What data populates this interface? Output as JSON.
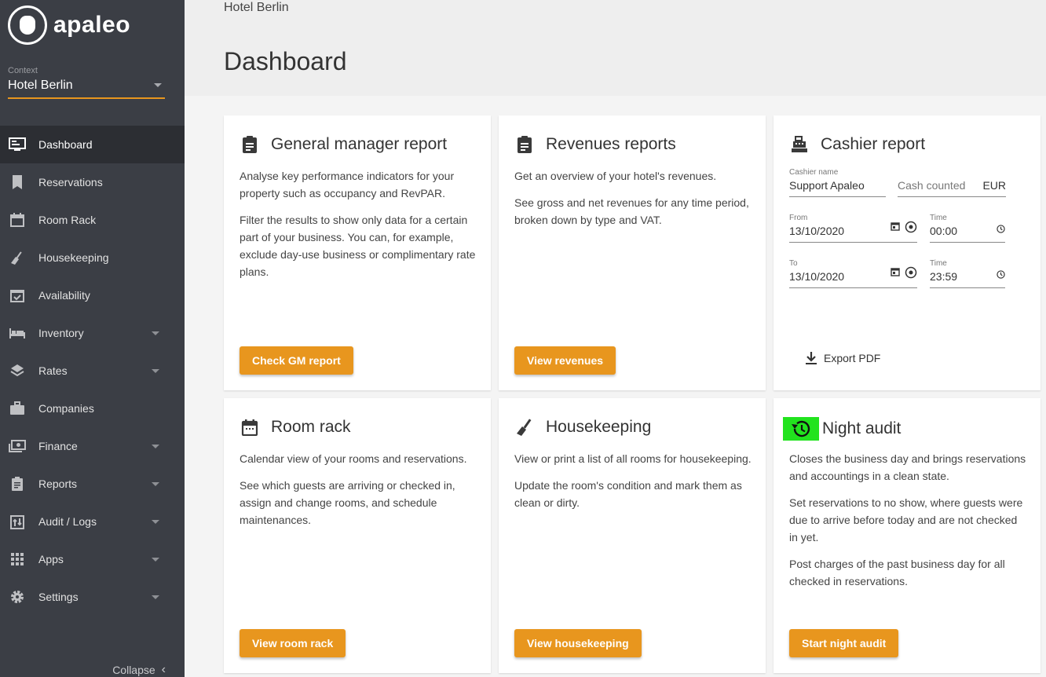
{
  "app": {
    "name": "apaleo"
  },
  "sidebar": {
    "context_label": "Context",
    "context_value": "Hotel Berlin",
    "items": [
      {
        "label": "Dashboard",
        "icon": "monitor-icon",
        "active": true,
        "expandable": false
      },
      {
        "label": "Reservations",
        "icon": "bookmark-icon",
        "expandable": false
      },
      {
        "label": "Room Rack",
        "icon": "calendar-icon",
        "expandable": false
      },
      {
        "label": "Housekeeping",
        "icon": "broom-icon",
        "expandable": false
      },
      {
        "label": "Availability",
        "icon": "calendar-check-icon",
        "expandable": false
      },
      {
        "label": "Inventory",
        "icon": "bed-icon",
        "expandable": true
      },
      {
        "label": "Rates",
        "icon": "layers-icon",
        "expandable": true
      },
      {
        "label": "Companies",
        "icon": "briefcase-icon",
        "expandable": false
      },
      {
        "label": "Finance",
        "icon": "money-icon",
        "expandable": true
      },
      {
        "label": "Reports",
        "icon": "clipboard-icon",
        "expandable": true
      },
      {
        "label": "Audit / Logs",
        "icon": "audit-icon",
        "expandable": true
      },
      {
        "label": "Apps",
        "icon": "apps-grid-icon",
        "expandable": true
      },
      {
        "label": "Settings",
        "icon": "gear-icon",
        "expandable": true
      }
    ],
    "collapse_label": "Collapse"
  },
  "header": {
    "breadcrumb": "Hotel Berlin",
    "title": "Dashboard"
  },
  "cards": {
    "gm": {
      "title": "General manager report",
      "paragraphs": [
        "Analyse key performance indicators for your property such as occupancy and RevPAR.",
        "Filter the results to show only data for a certain part of your business. You can, for example, exclude day-use business or complimentary rate plans."
      ],
      "button": "Check GM report"
    },
    "revenues": {
      "title": "Revenues reports",
      "paragraphs": [
        "Get an overview of your hotel's revenues.",
        "See gross and net revenues for any time period, broken down by type and VAT."
      ],
      "button": "View revenues"
    },
    "cashier": {
      "title": "Cashier report",
      "cashier_name_label": "Cashier name",
      "cashier_name_value": "Support Apaleo",
      "cash_counted_placeholder": "Cash counted",
      "currency": "EUR",
      "from_label": "From",
      "from_date": "13/10/2020",
      "from_time_label": "Time",
      "from_time": "00:00",
      "to_label": "To",
      "to_date": "13/10/2020",
      "to_time_label": "Time",
      "to_time": "23:59",
      "export_label": "Export PDF"
    },
    "roomrack": {
      "title": "Room rack",
      "paragraphs": [
        "Calendar view of your rooms and reservations.",
        "See which guests are arriving or checked in, assign and change rooms, and schedule maintenances."
      ],
      "button": "View room rack"
    },
    "housekeeping": {
      "title": "Housekeeping",
      "paragraphs": [
        "View or print a list of all rooms for housekeeping.",
        "Update the room's condition and mark them as clean or dirty."
      ],
      "button": "View housekeeping"
    },
    "nightaudit": {
      "title": "Night audit",
      "paragraphs": [
        "Closes the business day and brings reservations and accountings in a clean state.",
        "Set reservations to no show, where guests were due to arrive before today and are not checked in yet.",
        "Post charges of the past business day for all checked in reservations."
      ],
      "button": "Start night audit"
    }
  },
  "colors": {
    "sidebar_bg": "#3b3e45",
    "accent": "#e8961e",
    "highlight": "#22e31e"
  }
}
